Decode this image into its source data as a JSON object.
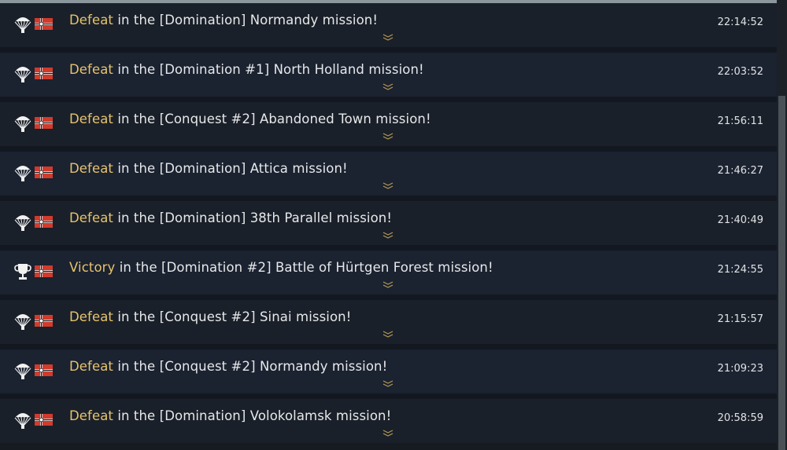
{
  "colors": {
    "accent": "#e6c36e",
    "text": "#e6e8ea",
    "background": "#161b22"
  },
  "battles": [
    {
      "result": "Defeat",
      "icon": "parachute-icon",
      "text": " in the [Domination] Normandy mission!",
      "time": "22:14:52"
    },
    {
      "result": "Defeat",
      "icon": "parachute-icon",
      "text": " in the [Domination #1] North Holland mission!",
      "time": "22:03:52"
    },
    {
      "result": "Defeat",
      "icon": "parachute-icon",
      "text": " in the [Conquest #2] Abandoned Town mission!",
      "time": "21:56:11"
    },
    {
      "result": "Defeat",
      "icon": "parachute-icon",
      "text": " in the [Domination] Attica mission!",
      "time": "21:46:27"
    },
    {
      "result": "Defeat",
      "icon": "parachute-icon",
      "text": " in the [Domination] 38th Parallel mission!",
      "time": "21:40:49"
    },
    {
      "result": "Victory",
      "icon": "trophy-icon",
      "text": " in the [Domination #2] Battle of Hürtgen Forest mission!",
      "time": "21:24:55"
    },
    {
      "result": "Defeat",
      "icon": "parachute-icon",
      "text": " in the [Conquest #2] Sinai mission!",
      "time": "21:15:57"
    },
    {
      "result": "Defeat",
      "icon": "parachute-icon",
      "text": " in the [Conquest #2] Normandy mission!",
      "time": "21:09:23"
    },
    {
      "result": "Defeat",
      "icon": "parachute-icon",
      "text": " in the [Domination] Volokolamsk mission!",
      "time": "20:58:59"
    }
  ]
}
